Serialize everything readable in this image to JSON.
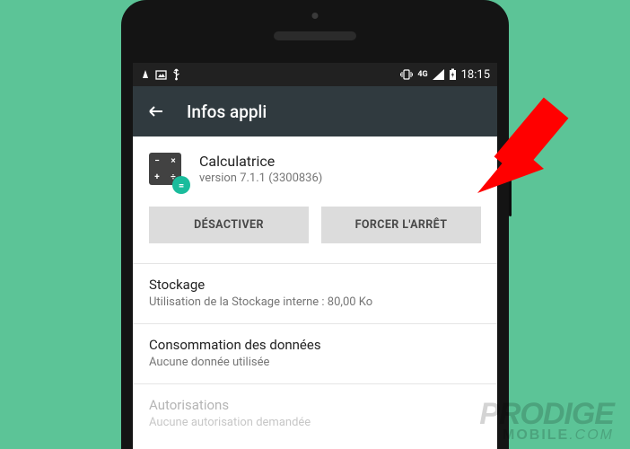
{
  "status_bar": {
    "time": "18:15",
    "net_label": "4G"
  },
  "app_bar": {
    "title": "Infos appli"
  },
  "app": {
    "name": "Calculatrice",
    "version": "version 7.1.1 (3300836)"
  },
  "buttons": {
    "disable": "DÉSACTIVER",
    "force_stop": "FORCER L'ARRÊT"
  },
  "sections": {
    "storage": {
      "title": "Stockage",
      "sub": "Utilisation de la Stockage interne : 80,00 Ko"
    },
    "data": {
      "title": "Consommation des données",
      "sub": "Aucune donnée utilisée"
    },
    "permissions": {
      "title": "Autorisations",
      "sub": "Aucune autorisation demandée"
    }
  },
  "watermark": {
    "line1": "PRODIGE",
    "line2a": "MOBILE",
    "line2b": ".COM"
  },
  "colors": {
    "bg": "#5cc497",
    "arrow": "#ff0000"
  }
}
